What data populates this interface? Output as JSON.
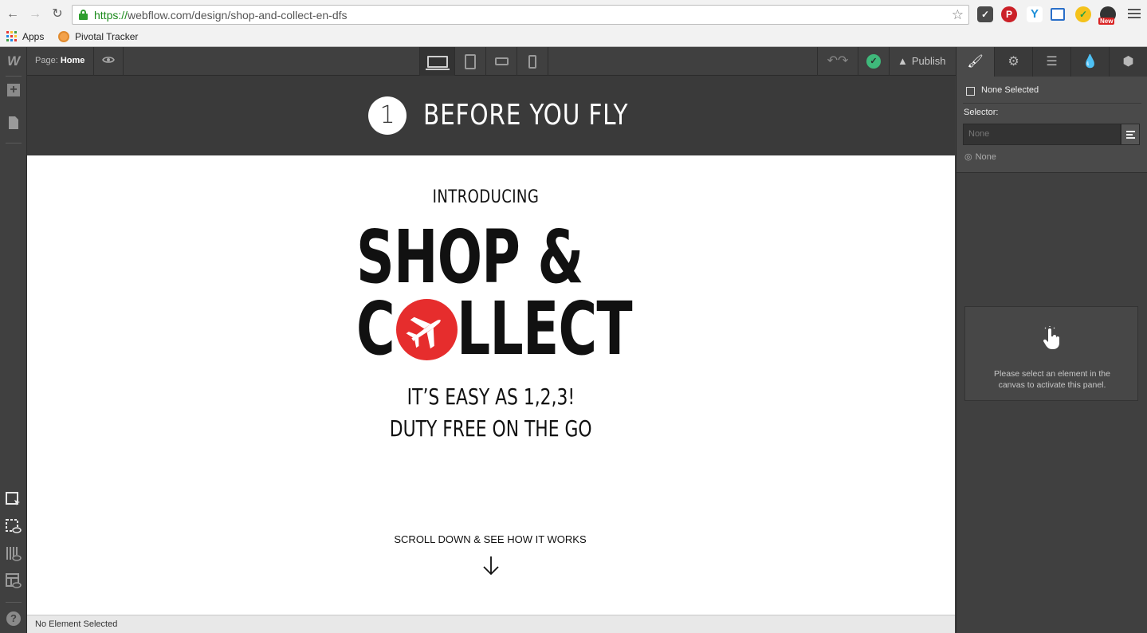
{
  "browser": {
    "url_scheme": "https://",
    "url_rest": "webflow.com/design/shop-and-collect-en-dfs",
    "bookmarks": [
      "Apps",
      "Pivotal Tracker"
    ],
    "new_badge": "New"
  },
  "webflow": {
    "page_label": "Page:",
    "page_name": "Home",
    "publish_label": "Publish",
    "status_text": "No Element Selected"
  },
  "canvas": {
    "step_number": "1",
    "step_title": "BEFORE YOU FLY",
    "intro": "INTRODUCING",
    "headline_line1": "SHOP &",
    "headline_c": "C",
    "headline_rest": "LLECT",
    "tagline1": "IT’S EASY AS 1,2,3!",
    "tagline2": "DUTY FREE ON THE GO",
    "scroll_text": "SCROLL DOWN & SEE HOW IT WORKS",
    "accent_color": "#e62d2d"
  },
  "panel": {
    "none_selected": "None Selected",
    "selector_label": "Selector:",
    "selector_placeholder": "None",
    "state_label": "None",
    "inactive_message": "Please select an element in the canvas to activate this panel."
  }
}
